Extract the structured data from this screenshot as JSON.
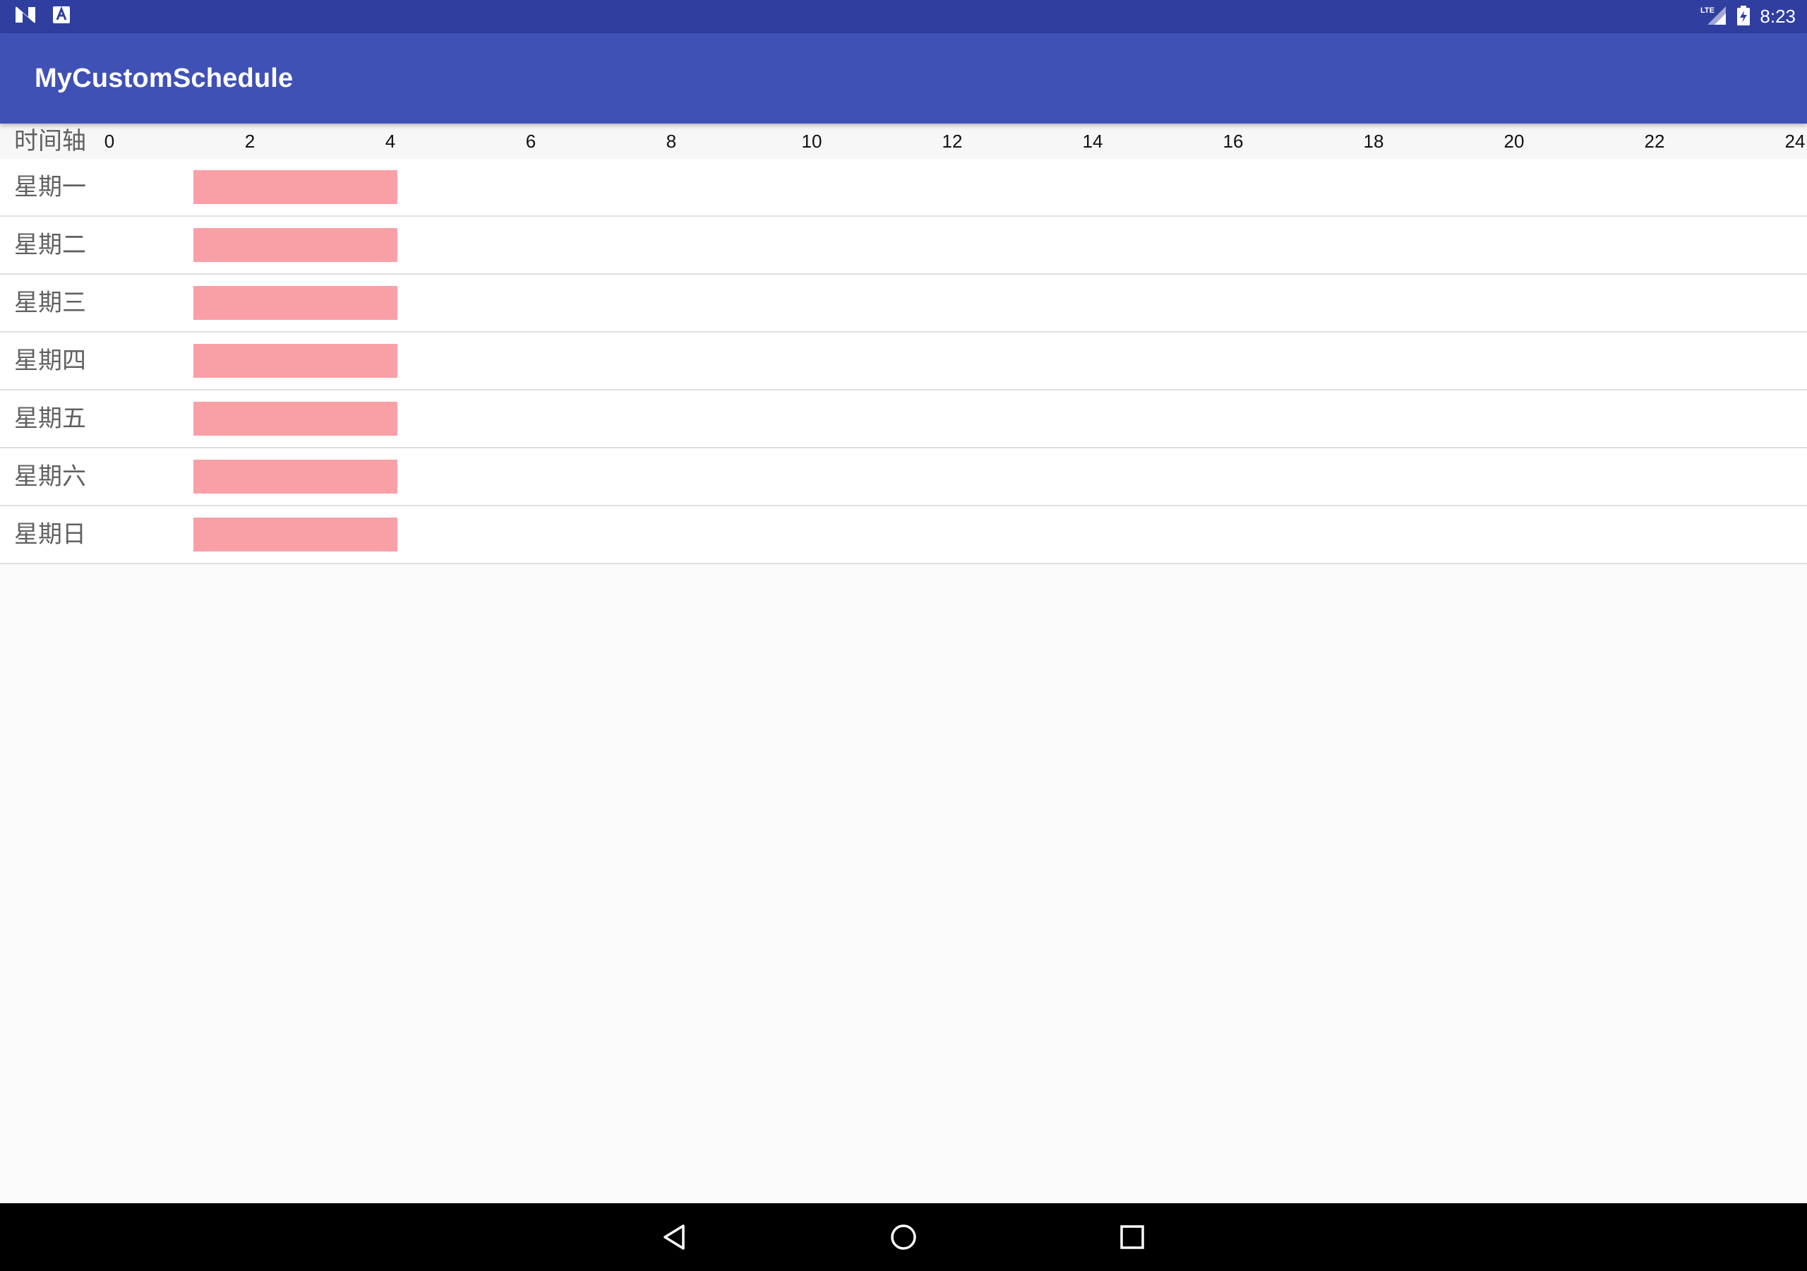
{
  "status_bar": {
    "time": "8:23",
    "network": "LTE",
    "icons": [
      "n-notification-icon",
      "a-notification-icon",
      "lte-signal-icon",
      "battery-icon"
    ]
  },
  "app_bar": {
    "title": "MyCustomSchedule"
  },
  "schedule": {
    "axis_title": "时间轴",
    "ticks": [
      "0",
      "2",
      "4",
      "6",
      "8",
      "10",
      "12",
      "14",
      "16",
      "18",
      "20",
      "22",
      "24"
    ],
    "days": [
      {
        "label": "星期一",
        "start": 1.2,
        "end": 4.1
      },
      {
        "label": "星期二",
        "start": 1.2,
        "end": 4.1
      },
      {
        "label": "星期三",
        "start": 1.2,
        "end": 4.1
      },
      {
        "label": "星期四",
        "start": 1.2,
        "end": 4.1
      },
      {
        "label": "星期五",
        "start": 1.2,
        "end": 4.1
      },
      {
        "label": "星期六",
        "start": 1.2,
        "end": 4.1
      },
      {
        "label": "星期日",
        "start": 1.2,
        "end": 4.1
      }
    ],
    "bar_color": "#f9a0a6"
  },
  "nav_bar": {
    "buttons": [
      "back-icon",
      "home-icon",
      "recents-icon"
    ]
  },
  "colors": {
    "status_bar": "#303f9f",
    "app_bar": "#3f51b5",
    "accent": "#f9a0a6"
  }
}
